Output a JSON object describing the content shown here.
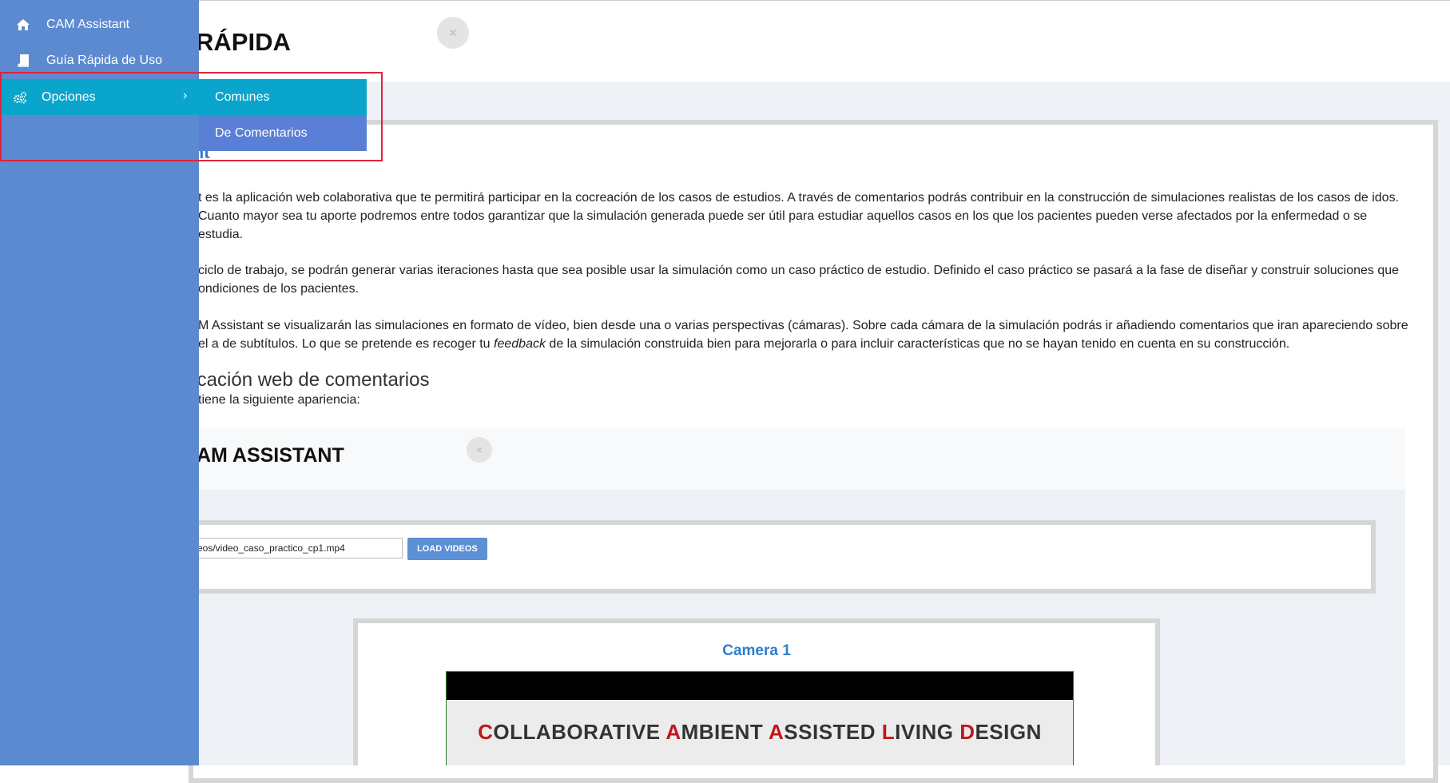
{
  "header": {
    "title": "RÁPIDA",
    "expand_icon": "expand-arrows-icon"
  },
  "main": {
    "section_heading": "stant",
    "paragraphs": [
      "t es la aplicación web colaborativa que te permitirá participar en la cocreación de los casos de estudios. A través de comentarios podrás contribuir en la construcción de simulaciones realistas de los casos de idos. Cuanto mayor sea tu aporte podremos entre todos garantizar que la simulación generada puede ser útil para estudiar aquellos casos en los que los pacientes pueden verse afectados por la enfermedad o se estudia.",
      "ciclo de trabajo, se podrán generar varias iteraciones hasta que sea posible usar la simulación como un caso práctico de estudio. Definido el caso práctico se pasará a la fase de diseñar y construir soluciones que ondiciones de los pacientes.",
      "M Assistant se visualizarán las simulaciones en formato de vídeo, bien desde una o varias perspectivas (cámaras). Sobre cada cámara de la simulación podrás ir añadiendo comentarios que iran apareciendo sobre el a de subtítulos. Lo que se pretende es recoger tu feedback de la simulación construida bien para mejorarla o para incluir características que no se hayan tenido en cuenta en su construcción."
    ],
    "subheading": "licación web de comentarios",
    "subtext": "tiene la siguiente apariencia:"
  },
  "embed": {
    "title": "AM ASSISTANT",
    "video_input_value": "eos/video_caso_practico_cp1.mp4",
    "load_button": "LOAD VIDEOS",
    "camera_title": "Camera 1",
    "video_caption_words": [
      {
        "cap": "C",
        "rest": "OLLABORATIVE "
      },
      {
        "cap": "A",
        "rest": "MBIENT "
      },
      {
        "cap": "A",
        "rest": "SSISTED "
      },
      {
        "cap": "L",
        "rest": "IVING "
      },
      {
        "cap": "D",
        "rest": "ESIGN"
      }
    ],
    "caption_accent_color": "#c0171b"
  },
  "sidebar": {
    "items": [
      {
        "label": "CAM Assistant",
        "icon": "home-icon"
      },
      {
        "label": "Guía Rápida de Uso",
        "icon": "book-icon"
      },
      {
        "label": "Opciones",
        "icon": "gears-icon"
      }
    ],
    "submenu": [
      {
        "label": "Comunes"
      },
      {
        "label": "De Comentarios"
      }
    ],
    "colors": {
      "sidebar_bg": "#5b8ad0",
      "active_bg": "#0aa5cc",
      "highlight_border": "#e0233d"
    }
  }
}
